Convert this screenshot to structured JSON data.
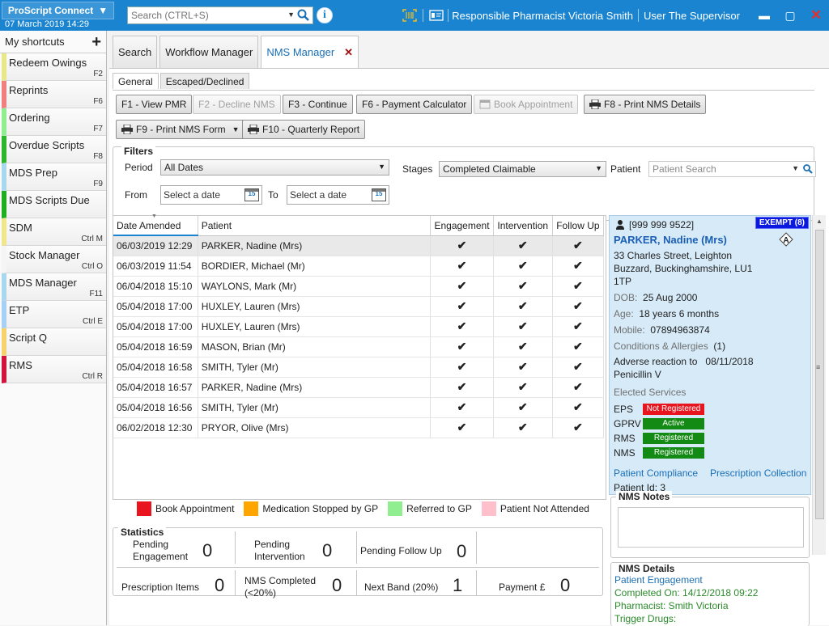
{
  "app": {
    "name": "ProScript Connect",
    "date": "07 March 2019 14:29"
  },
  "search": {
    "placeholder": "Search (CTRL+S)"
  },
  "topbar": {
    "pharmacist": "Responsible Pharmacist Victoria Smith",
    "user": "User The Supervisor"
  },
  "sidebar": {
    "title": "My shortcuts",
    "items": [
      {
        "label": "Redeem Owings",
        "key": "F2",
        "color": "#e8e88a"
      },
      {
        "label": "Reprints",
        "key": "F6",
        "color": "#f08080"
      },
      {
        "label": "Ordering",
        "key": "F7",
        "color": "#90ee90"
      },
      {
        "label": "Overdue Scripts",
        "key": "F8",
        "color": "#2db52d"
      },
      {
        "label": "MDS Prep",
        "key": "F9",
        "color": "#a8d8f0"
      },
      {
        "label": "MDS Scripts Due",
        "key": "",
        "color": "#1fae1f"
      },
      {
        "label": "SDM",
        "key": "Ctrl M",
        "color": "#f0e68c"
      },
      {
        "label": "Stock Manager",
        "key": "Ctrl O",
        "color": "#f5f5f5"
      },
      {
        "label": "MDS Manager",
        "key": "F11",
        "color": "#a8d8f0"
      },
      {
        "label": "ETP",
        "key": "Ctrl E",
        "color": "#a8d0f5"
      },
      {
        "label": "Script Q",
        "key": "",
        "color": "#f5d26e"
      },
      {
        "label": "RMS",
        "key": "Ctrl R",
        "color": "#d2143c"
      }
    ]
  },
  "tabs": {
    "search": "Search",
    "workflow": "Workflow Manager",
    "nms": "NMS Manager"
  },
  "subtabs": {
    "general": "General",
    "escaped": "Escaped/Declined"
  },
  "toolbar": {
    "view_pmr": "F1 - View PMR",
    "decline": "F2 - Decline NMS",
    "continue": "F3 - Continue",
    "payment": "F6 - Payment Calculator",
    "book": "Book Appointment",
    "print_details": "F8 - Print NMS Details",
    "print_form": "F9 - Print NMS Form",
    "quarterly": "F10 - Quarterly Report"
  },
  "filters": {
    "title": "Filters",
    "period_label": "Period",
    "period_value": "All Dates",
    "stages_label": "Stages",
    "stages_value": "Completed Claimable",
    "patient_label": "Patient",
    "patient_placeholder": "Patient Search",
    "from_label": "From",
    "to_label": "To",
    "date_placeholder": "Select a date",
    "cal_day": "15"
  },
  "grid": {
    "headers": [
      "Date Amended",
      "Patient",
      "Engagement",
      "Intervention",
      "Follow Up"
    ],
    "check": "✔",
    "rows": [
      {
        "date": "06/03/2019 12:29",
        "patient": "PARKER, Nadine (Mrs)"
      },
      {
        "date": "06/03/2019 11:54",
        "patient": "BORDIER, Michael (Mr)"
      },
      {
        "date": "06/04/2018 15:10",
        "patient": "WAYLONS, Mark (Mr)"
      },
      {
        "date": "05/04/2018 17:00",
        "patient": "HUXLEY, Lauren (Mrs)"
      },
      {
        "date": "05/04/2018 17:00",
        "patient": "HUXLEY, Lauren (Mrs)"
      },
      {
        "date": "05/04/2018 16:59",
        "patient": "MASON, Brian (Mr)"
      },
      {
        "date": "05/04/2018 16:58",
        "patient": "SMITH, Tyler (Mr)"
      },
      {
        "date": "05/04/2018 16:57",
        "patient": "PARKER, Nadine (Mrs)"
      },
      {
        "date": "05/04/2018 16:56",
        "patient": "SMITH, Tyler (Mr)"
      },
      {
        "date": "06/02/2018 12:30",
        "patient": "PRYOR, Olive (Mrs)"
      }
    ]
  },
  "legend": {
    "book": {
      "label": "Book Appointment",
      "color": "#e8141e"
    },
    "stopped": {
      "label": "Medication Stopped by GP",
      "color": "#ffa500"
    },
    "referred": {
      "label": "Referred to GP",
      "color": "#90ee90"
    },
    "not_attended": {
      "label": "Patient Not Attended",
      "color": "#ffc0cb"
    }
  },
  "statistics": {
    "title": "Statistics",
    "pending_engagement": {
      "label1": "Pending",
      "label2": "Engagement",
      "value": "0"
    },
    "pending_intervention": {
      "label1": "Pending",
      "label2": "Intervention",
      "value": "0"
    },
    "pending_followup": {
      "label": "Pending Follow Up",
      "value": "0"
    },
    "prescription_items": {
      "label": "Prescription Items",
      "value": "0"
    },
    "nms_completed": {
      "label1": "NMS Completed",
      "label2": "(<20%)",
      "value": "0"
    },
    "next_band": {
      "label": "Next Band (20%)",
      "value": "1"
    },
    "payment": {
      "label": "Payment £",
      "value": "0"
    }
  },
  "patient": {
    "nhs": "[999 999 9522]",
    "exempt": "EXEMPT (8)",
    "name": "PARKER, Nadine (Mrs)",
    "addr1": "33 Charles Street, Leighton",
    "addr2": "Buzzard, Buckinghamshire, LU1",
    "addr3": "1TP",
    "dob_label": "DOB:",
    "dob": "25 Aug 2000",
    "age_label": "Age:",
    "age": "18 years 6 months",
    "mobile_label": "Mobile:",
    "mobile": "07894963874",
    "conditions_label": "Conditions & Allergies",
    "conditions_count": "(1)",
    "adverse": "Adverse reaction to",
    "adverse_date": "08/11/2018",
    "drug": "Penicillin V",
    "elected_title": "Elected Services",
    "services": [
      {
        "name": "EPS",
        "status": "Not Registered",
        "color": "#e8141e"
      },
      {
        "name": "GPRV",
        "status": "Active",
        "color": "#138a13"
      },
      {
        "name": "RMS",
        "status": "Registered",
        "color": "#138a13"
      },
      {
        "name": "NMS",
        "status": "Registered",
        "color": "#138a13"
      }
    ],
    "compliance_link": "Patient Compliance",
    "collection_link": "Prescription Collection",
    "patient_id": "Patient Id:  3"
  },
  "notes": {
    "title": "NMS Notes"
  },
  "details": {
    "title": "NMS Details",
    "engagement": "Patient Engagement",
    "completed": "Completed On: 14/12/2018 09:22",
    "pharmacist": "Pharmacist: Smith Victoria",
    "trigger": "Trigger Drugs:"
  }
}
